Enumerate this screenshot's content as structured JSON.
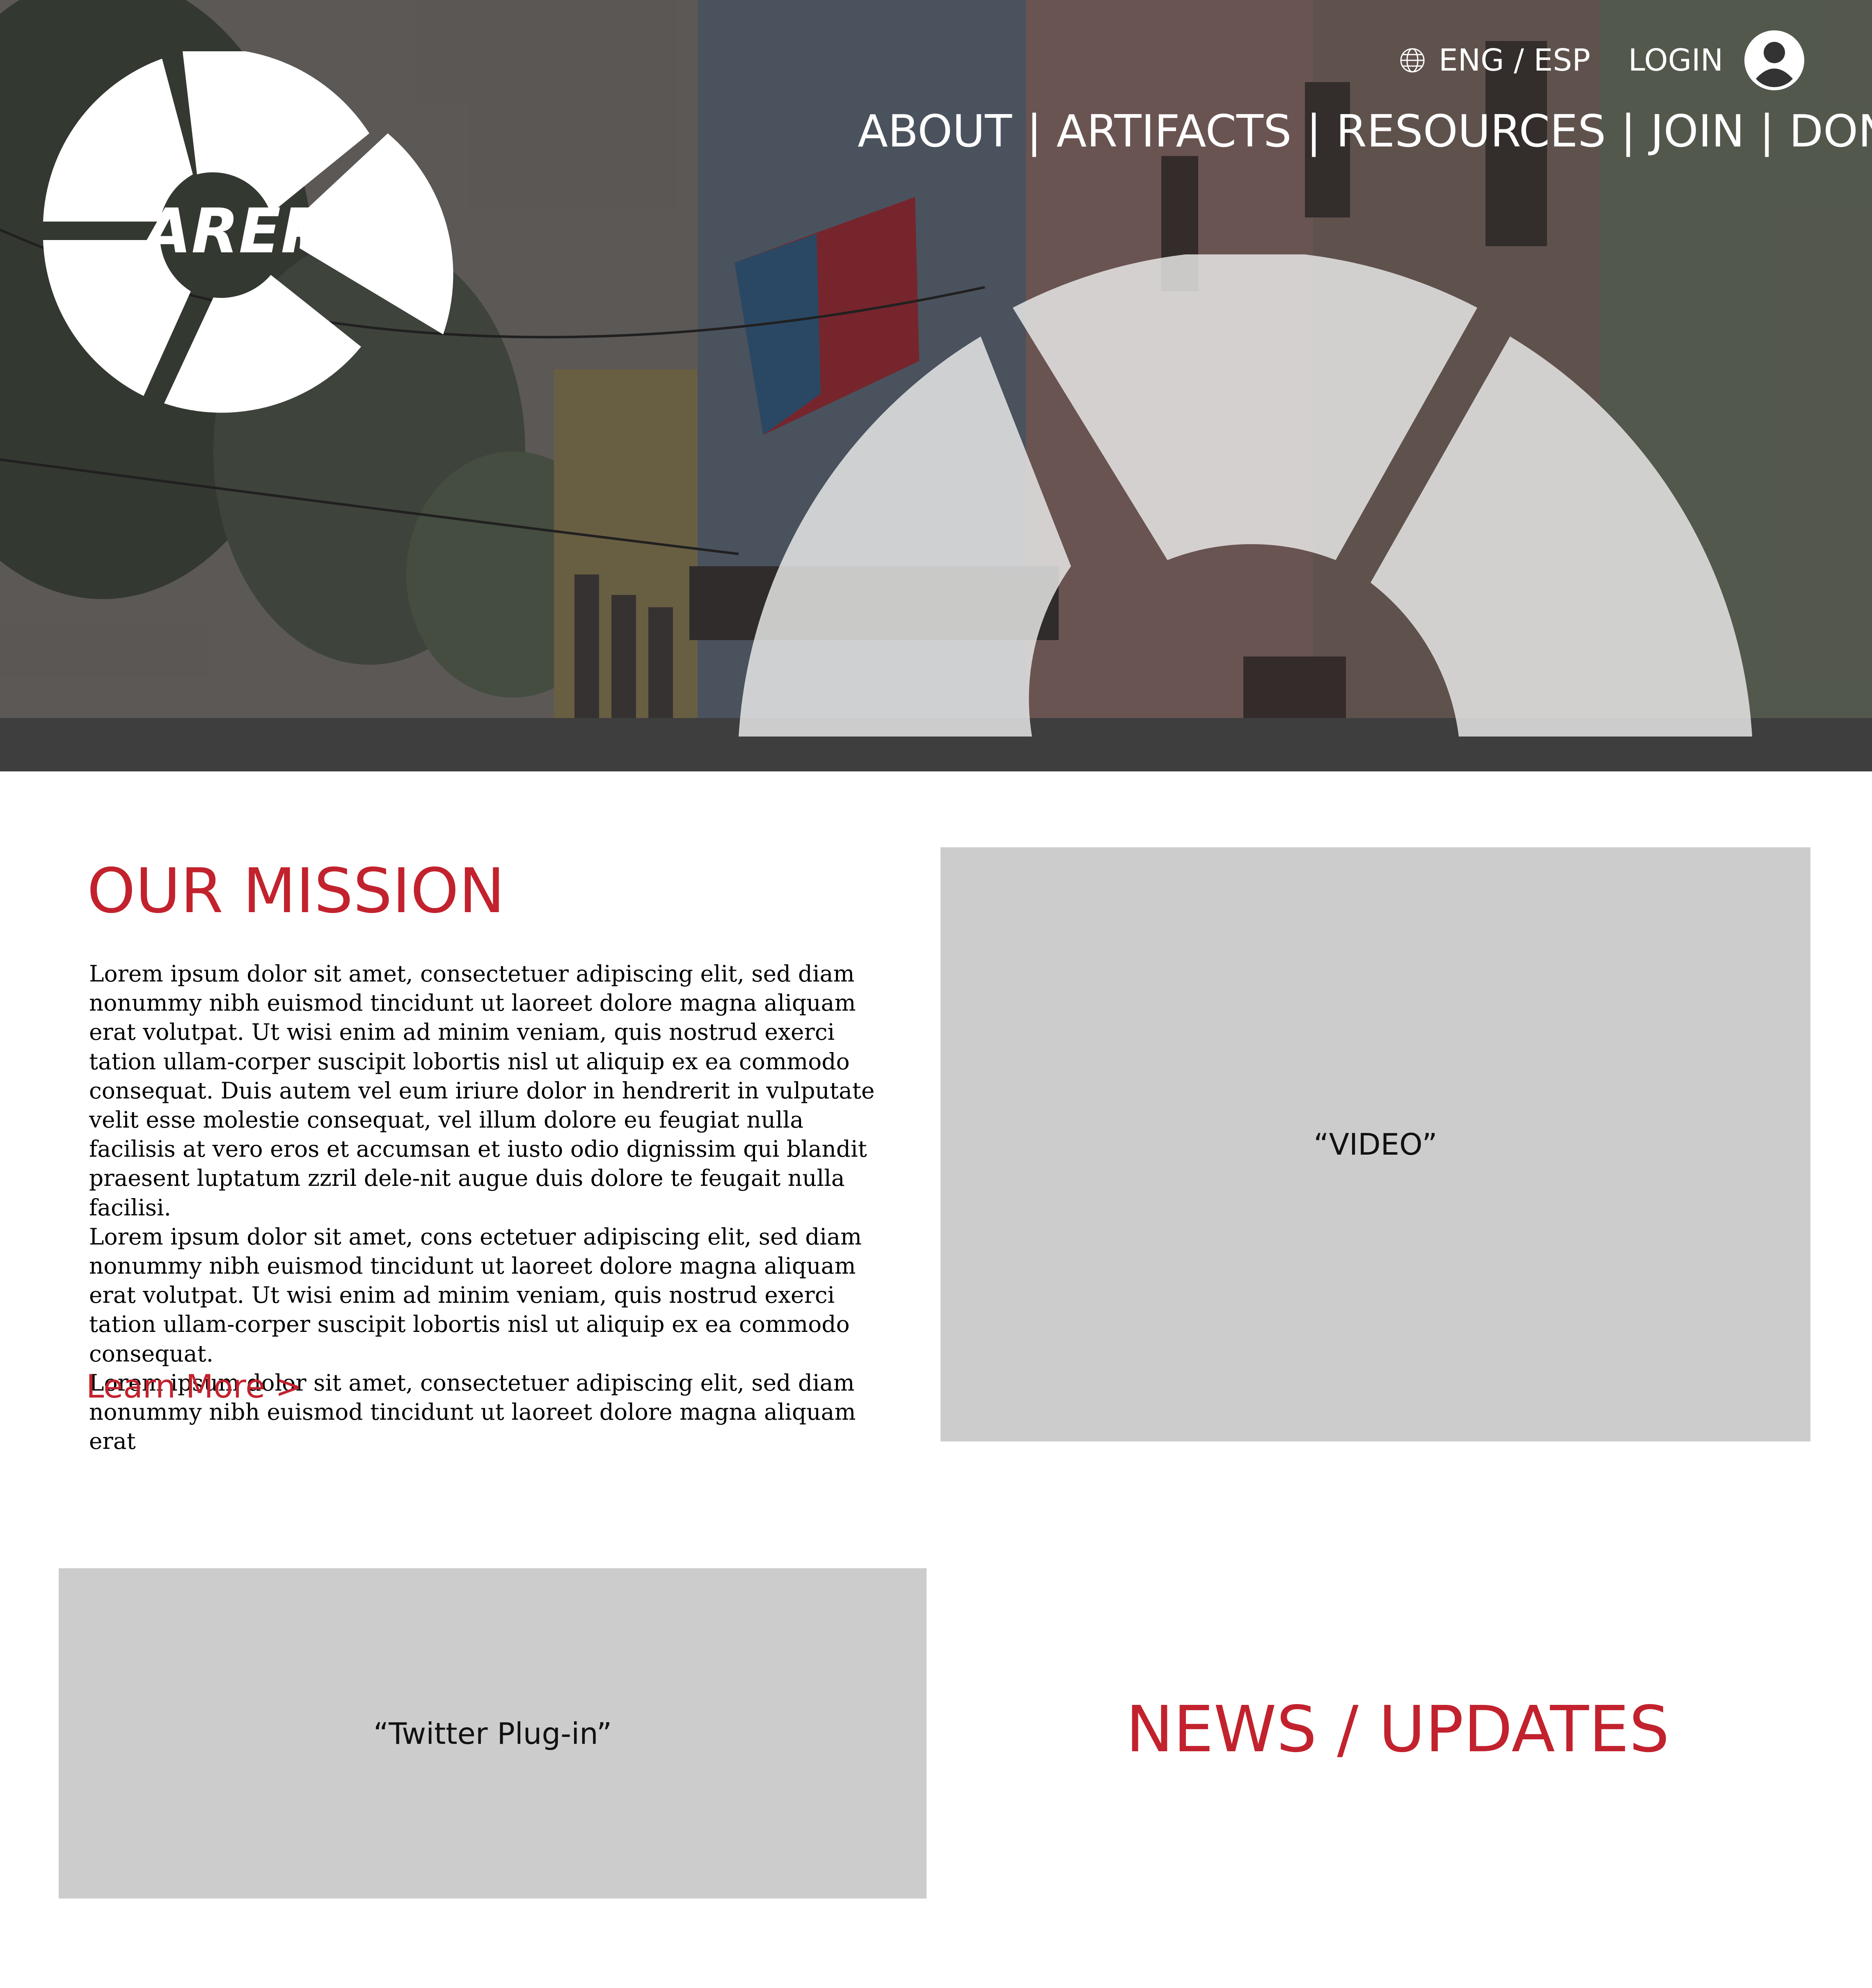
{
  "header": {
    "logo_text": "AREPR",
    "language_toggle": "ENG / ESP",
    "login_label": "LOGIN",
    "nav": [
      {
        "label": "ABOUT"
      },
      {
        "label": "ARTIFACTS"
      },
      {
        "label": "RESOURCES"
      },
      {
        "label": "JOIN"
      },
      {
        "label": "DONATE"
      }
    ],
    "nav_separator": "|"
  },
  "mission": {
    "title": "OUR MISSION",
    "paragraphs": [
      "Lorem ipsum dolor sit amet, consectetuer adipiscing elit, sed diam nonummy nibh euismod tincidunt ut laoreet dolore magna aliquam erat volutpat. Ut wisi enim ad minim veniam, quis nostrud exerci tation ullam-corper suscipit lobortis nisl ut aliquip ex ea commodo consequat. Duis autem vel eum iriure dolor in hendrerit in vulputate velit esse molestie consequat, vel illum dolore eu feugiat nulla facilisis at vero eros et accumsan et iusto odio dignissim qui blandit praesent luptatum zzril dele-nit augue duis dolore te feugait nulla facilisi.",
      "Lorem ipsum dolor sit amet, cons ectetuer adipiscing elit, sed diam nonummy nibh euismod tincidunt ut laoreet dolore magna aliquam erat volutpat. Ut wisi enim ad minim veniam, quis nostrud exerci tation ullam-corper suscipit lobortis nisl ut aliquip ex ea commodo consequat.",
      "Lorem ipsum dolor sit amet, consectetuer adipiscing elit, sed diam nonummy nibh euismod tincidunt ut laoreet dolore magna aliquam erat"
    ],
    "learn_more": "Learn More >"
  },
  "video": {
    "label": "“VIDEO”"
  },
  "twitter": {
    "label": "“Twitter Plug-in”"
  },
  "news": {
    "title": "NEWS / UPDATES"
  },
  "colors": {
    "accent_red": "#c2222d",
    "placeholder_gray": "#cccccc",
    "header_text": "#ffffff"
  },
  "icons": [
    "globe-icon",
    "user-account-icon",
    "arepr-logo"
  ]
}
